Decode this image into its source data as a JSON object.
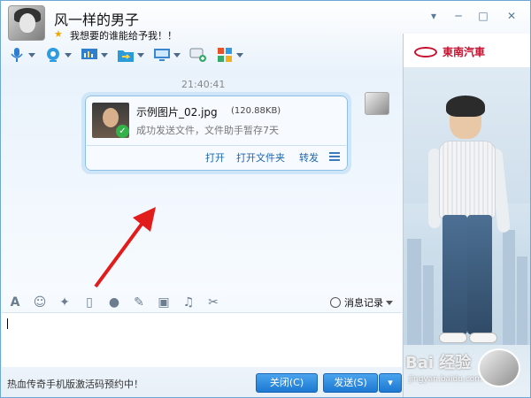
{
  "title_bar": {
    "nickname": "风一样的男子",
    "signature": "我想要的谁能给予我！！"
  },
  "window_controls": {
    "pin": "▾",
    "minimize": "─",
    "maximize": "□",
    "close": "✕"
  },
  "toolbar": {
    "items": [
      {
        "name": "voice-call",
        "icon": "microphone-icon",
        "color": "#2f7fd0"
      },
      {
        "name": "video-call",
        "icon": "webcam-icon",
        "color": "#2f9be0"
      },
      {
        "name": "remote-assist",
        "icon": "presentation-icon",
        "color": "#2f7fd0"
      },
      {
        "name": "send-file",
        "icon": "folder-arrow-icon",
        "color": "#2a9ad8"
      },
      {
        "name": "remote-desktop",
        "icon": "monitor-icon",
        "color": "#3a86cf"
      },
      {
        "name": "create-group",
        "icon": "chat-plus-icon",
        "color": "#37a96b"
      },
      {
        "name": "apps",
        "icon": "apps-grid-icon",
        "color": "#e5532b"
      }
    ]
  },
  "chat": {
    "timestamp": "21:40:41",
    "file_message": {
      "file_name": "示例图片_02.jpg",
      "file_size": "(120.88KB)",
      "status": "成功发送文件，文件助手暂存7天",
      "actions": {
        "open": "打开",
        "open_folder": "打开文件夹",
        "forward": "转发"
      }
    }
  },
  "input_toolbar": {
    "items": [
      "font-icon",
      "emoji-icon",
      "magic-icon",
      "shake-icon",
      "voice-msg-icon",
      "doodle-icon",
      "image-icon",
      "music-icon",
      "screenshot-icon"
    ],
    "history_label": "消息记录"
  },
  "input": {
    "value": ""
  },
  "footer": {
    "promo_text": "热血传奇手机版激活码预约中！",
    "close_label": "关闭(C)",
    "send_label": "发送(S)"
  },
  "right_panel": {
    "brand_name": "東南汽車",
    "watermark": "Bai 经验",
    "watermark_sub": "jingyan.baidu.com"
  }
}
